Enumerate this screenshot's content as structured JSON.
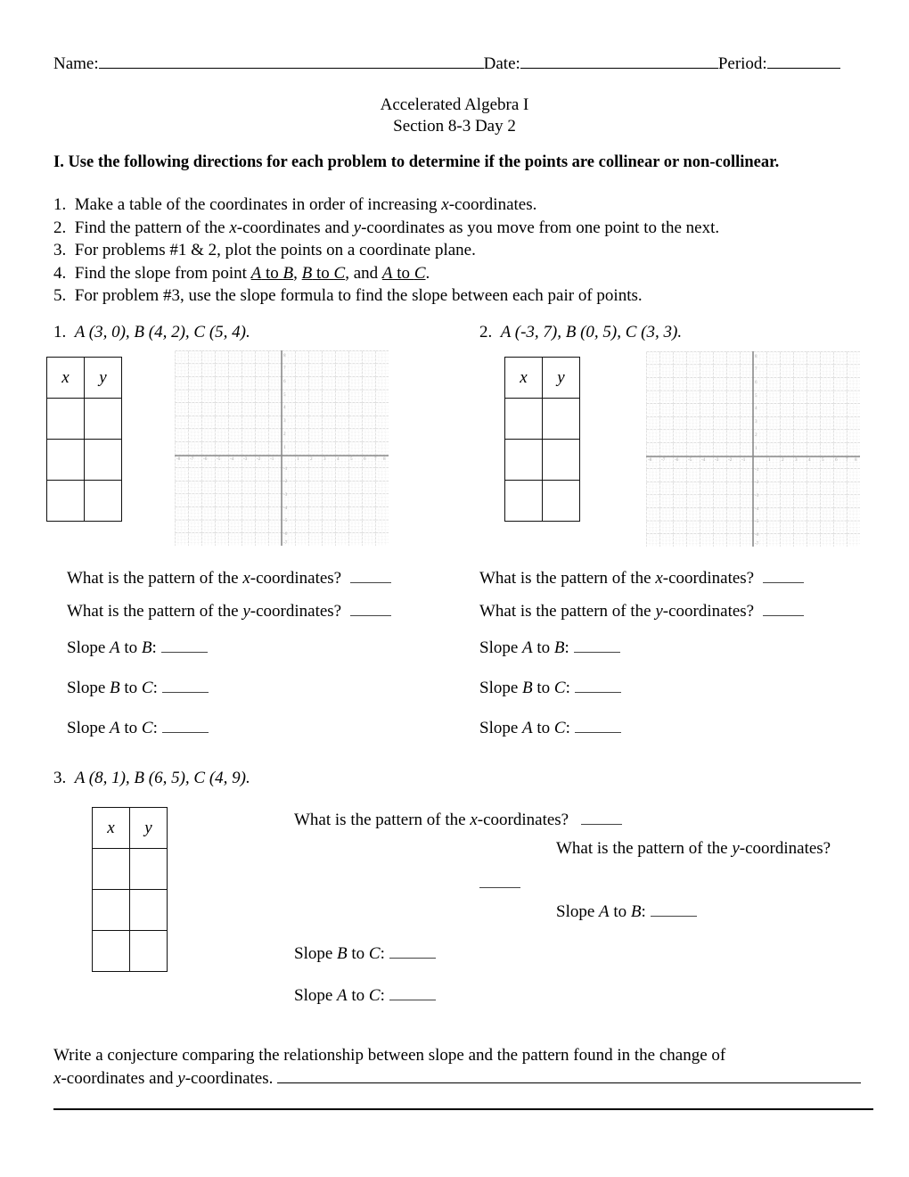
{
  "header": {
    "name_label": "Name:",
    "date_label": "Date:",
    "period_label": "Period:"
  },
  "title": {
    "line1": "Accelerated Algebra I",
    "line2": "Section 8-3 Day 2"
  },
  "section": {
    "heading": "I.  Use the following directions for each problem to determine if the points are collinear or non-collinear."
  },
  "directions": [
    "1.  Make a table of the coordinates in order of increasing x-coordinates.",
    "2.  Find the pattern of the x-coordinates and y-coordinates as you move from one point to the next.",
    "3.  For problems #1 & 2, plot the points on a coordinate plane.",
    "4.  Find the slope from point A to B, B to C, and A to C.",
    "5.  For problem #3, use the slope formula to find the slope between each pair of points."
  ],
  "problems": [
    {
      "number": "1.",
      "points_text": "A (3, 0), B (4, 2), C (5, 4).",
      "points": [
        {
          "label": "A",
          "x": 3,
          "y": 0
        },
        {
          "label": "B",
          "x": 4,
          "y": 2
        },
        {
          "label": "C",
          "x": 5,
          "y": 4
        }
      ]
    },
    {
      "number": "2.",
      "points_text": "A (-3, 7), B (0, 5), C (3, 3).",
      "points": [
        {
          "label": "A",
          "x": -3,
          "y": 7
        },
        {
          "label": "B",
          "x": 0,
          "y": 5
        },
        {
          "label": "C",
          "x": 3,
          "y": 3
        }
      ]
    },
    {
      "number": "3.",
      "points_text": "A (8, 1), B (6, 5), C (4, 9).",
      "points": [
        {
          "label": "A",
          "x": 8,
          "y": 1
        },
        {
          "label": "B",
          "x": 6,
          "y": 5
        },
        {
          "label": "C",
          "x": 4,
          "y": 9
        }
      ]
    }
  ],
  "table": {
    "headers": [
      "x",
      "y"
    ],
    "empty_rows": 3
  },
  "questions": {
    "pattern_x": "What is the pattern of the x-coordinates?",
    "pattern_y": "What is the pattern of the y-coordinates?",
    "slope_ab": "Slope A to B:",
    "slope_bc": "Slope B to C:",
    "slope_ac": "Slope A to C:"
  },
  "conjecture": {
    "line1": "Write a conjecture comparing the relationship between slope and the pattern found in the change of",
    "line2": "x-coordinates and y-coordinates."
  },
  "chart_data": [
    {
      "type": "scatter",
      "title": "",
      "xlabel": "",
      "ylabel": "",
      "xlim": [
        -8,
        8
      ],
      "ylim": [
        -8,
        8
      ],
      "xticks": [
        -8,
        -7,
        -6,
        -5,
        -4,
        -3,
        -2,
        -1,
        1,
        2,
        3,
        4,
        5,
        6,
        7,
        8
      ],
      "yticks": [
        -8,
        -7,
        -6,
        -5,
        -4,
        -3,
        -2,
        -1,
        1,
        2,
        3,
        4,
        5,
        6,
        7,
        8
      ],
      "grid": true,
      "minor_grid_step": 0.25,
      "major_grid_step": 1,
      "legend": "none",
      "series": [],
      "note": "Blank coordinate plane for problem 1"
    },
    {
      "type": "scatter",
      "title": "",
      "xlabel": "",
      "ylabel": "",
      "xlim": [
        -8,
        8
      ],
      "ylim": [
        -8,
        8
      ],
      "xticks": [
        -8,
        -7,
        -6,
        -5,
        -4,
        -3,
        -2,
        -1,
        1,
        2,
        3,
        4,
        5,
        6,
        7,
        8
      ],
      "yticks": [
        -8,
        -7,
        -6,
        -5,
        -4,
        -3,
        -2,
        -1,
        1,
        2,
        3,
        4,
        5,
        6,
        7,
        8
      ],
      "grid": true,
      "minor_grid_step": 0.25,
      "major_grid_step": 1,
      "legend": "none",
      "series": [],
      "note": "Blank coordinate plane for problem 2"
    }
  ],
  "colors": {
    "text": "#000000",
    "grid_minor": "#d8d8d8",
    "grid_major": "#c0c0c0",
    "axis": "#7a7a7a",
    "tick_label": "#9a9a9a",
    "table_border": "#111111"
  }
}
